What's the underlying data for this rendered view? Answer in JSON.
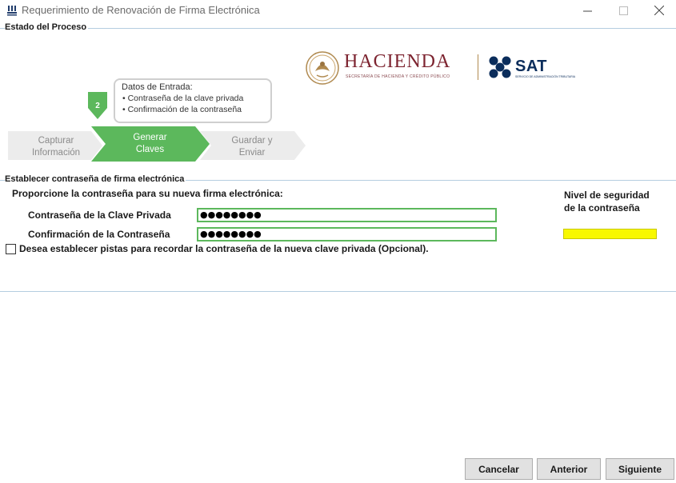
{
  "window": {
    "title": "Requerimiento de Renovación de Firma Electrónica",
    "icon": "app-icon",
    "controls": {
      "minimize": "—",
      "maximize": "☐",
      "close": "✕"
    }
  },
  "proceso": {
    "legend": "Estado del Proceso",
    "logo": {
      "hacienda": "HACIENDA",
      "hacienda_sub": "SECRETARÍA DE HACIENDA Y CRÉDITO PÚBLICO",
      "sat": "SAT",
      "sat_sub": "SERVICIO DE ADMINISTRACIÓN TRIBUTARIA"
    },
    "callout": {
      "title": "Datos de Entrada:",
      "items": [
        "•  Contraseña de la clave privada",
        "•  Confirmación de la contraseña"
      ]
    },
    "current_step_number": "2",
    "steps": [
      {
        "line1": "Capturar",
        "line2": "Información",
        "state": "inactive"
      },
      {
        "line1": "Generar",
        "line2": "Claves",
        "state": "active"
      },
      {
        "line1": "Guardar y",
        "line2": "Enviar",
        "state": "inactive"
      }
    ],
    "colors": {
      "active": "#5cb85c",
      "inactive": "#ececec"
    }
  },
  "establecer": {
    "legend": "Establecer contraseña de firma electrónica",
    "instruction": "Proporcione la contraseña para su nueva firma electrónica:",
    "password_label": "Contraseña de la Clave Privada",
    "password_value": "●●●●●●●●",
    "confirm_label": "Confirmación de la Contraseña",
    "confirm_value": "●●●●●●●●",
    "security_label_1": "Nivel de seguridad",
    "security_label_2": "de la contraseña",
    "security_color": "#f8f800",
    "hints_checkbox_label": "Desea establecer pistas para recordar la contraseña de la nueva clave privada (Opcional).",
    "hints_checked": false
  },
  "buttons": {
    "cancel": "Cancelar",
    "previous": "Anterior",
    "next": "Siguiente"
  }
}
